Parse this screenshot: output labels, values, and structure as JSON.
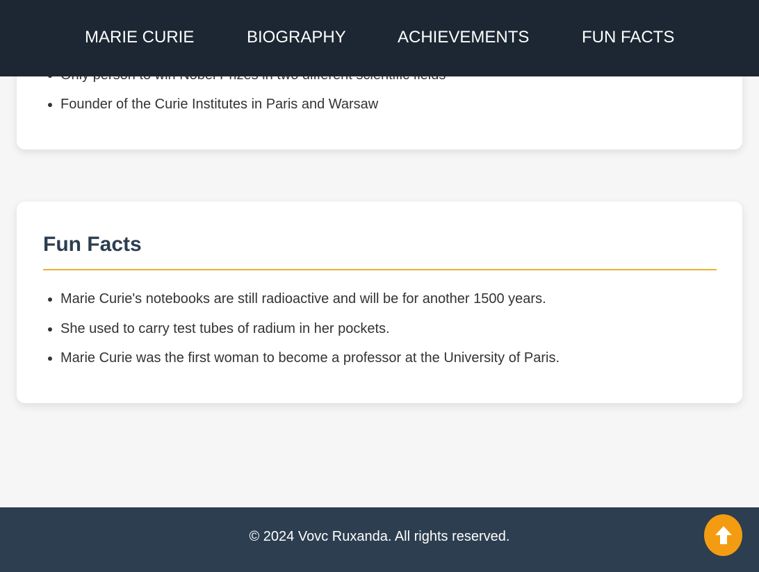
{
  "nav": {
    "items": [
      {
        "label": "MARIE CURIE"
      },
      {
        "label": "BIOGRAPHY"
      },
      {
        "label": "ACHIEVEMENTS"
      },
      {
        "label": "FUN FACTS"
      }
    ]
  },
  "achievements": {
    "items": [
      "Only person to win Nobel Prizes in two different scientific fields",
      "Founder of the Curie Institutes in Paris and Warsaw"
    ]
  },
  "fun_facts": {
    "title": "Fun Facts",
    "items": [
      "Marie Curie's notebooks are still radioactive and will be for another 1500 years.",
      "She used to carry test tubes of radium in her pockets.",
      "Marie Curie was the first woman to become a professor at the University of Paris."
    ]
  },
  "footer": {
    "text": "© 2024 Vovc Ruxanda. All rights reserved."
  },
  "back_to_top": {
    "icon": "arrow-up-icon"
  },
  "colors": {
    "navbar": "#1c2733",
    "footer": "#2c3e50",
    "accent": "#e8b22e",
    "back_to_top": "#f39c12",
    "heading": "#2c3e50"
  }
}
